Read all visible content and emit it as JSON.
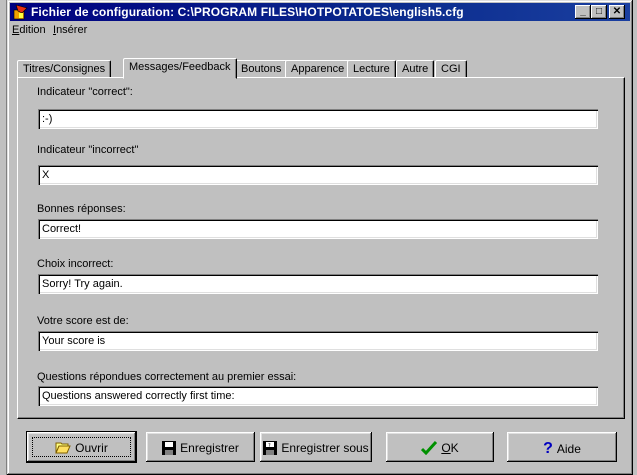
{
  "window": {
    "title": "Fichier de configuration: C:\\PROGRAM FILES\\HOTPOTATOES\\english5.cfg",
    "minimize": "_",
    "maximize": "□",
    "close": "✕"
  },
  "menu": {
    "items": [
      {
        "accel": "E",
        "rest": "dition"
      },
      {
        "accel": "I",
        "rest": "nsérer"
      }
    ]
  },
  "tabs": [
    {
      "label": "Titres/Consignes",
      "active": false
    },
    {
      "label": "Messages/Feedback",
      "active": true
    },
    {
      "label": "Boutons",
      "active": false
    },
    {
      "label": "Apparence",
      "active": false
    },
    {
      "label": "Lecture",
      "active": false
    },
    {
      "label": "Autre",
      "active": false
    },
    {
      "label": "CGI",
      "active": false
    }
  ],
  "fields": [
    {
      "label": "Indicateur \"correct\":",
      "value": ":-)"
    },
    {
      "label": "Indicateur \"incorrect\"",
      "value": "X"
    },
    {
      "label": "Bonnes réponses:",
      "value": "Correct!"
    },
    {
      "label": "Choix incorrect:",
      "value": "Sorry! Try again."
    },
    {
      "label": "Votre score est de:",
      "value": "Your score is"
    },
    {
      "label": "Questions répondues correctement au premier essai:",
      "value": "Questions answered correctly first time:"
    }
  ],
  "buttons": {
    "open": "Ouvrir",
    "save": "Enregistrer",
    "save_as": "Enregistrer sous",
    "ok": "OK",
    "help": "Aide"
  },
  "colors": {
    "titlebar": "#000080",
    "face": "#c0c0c0",
    "ok_check": "#009000",
    "help_mark": "#0000c0"
  }
}
